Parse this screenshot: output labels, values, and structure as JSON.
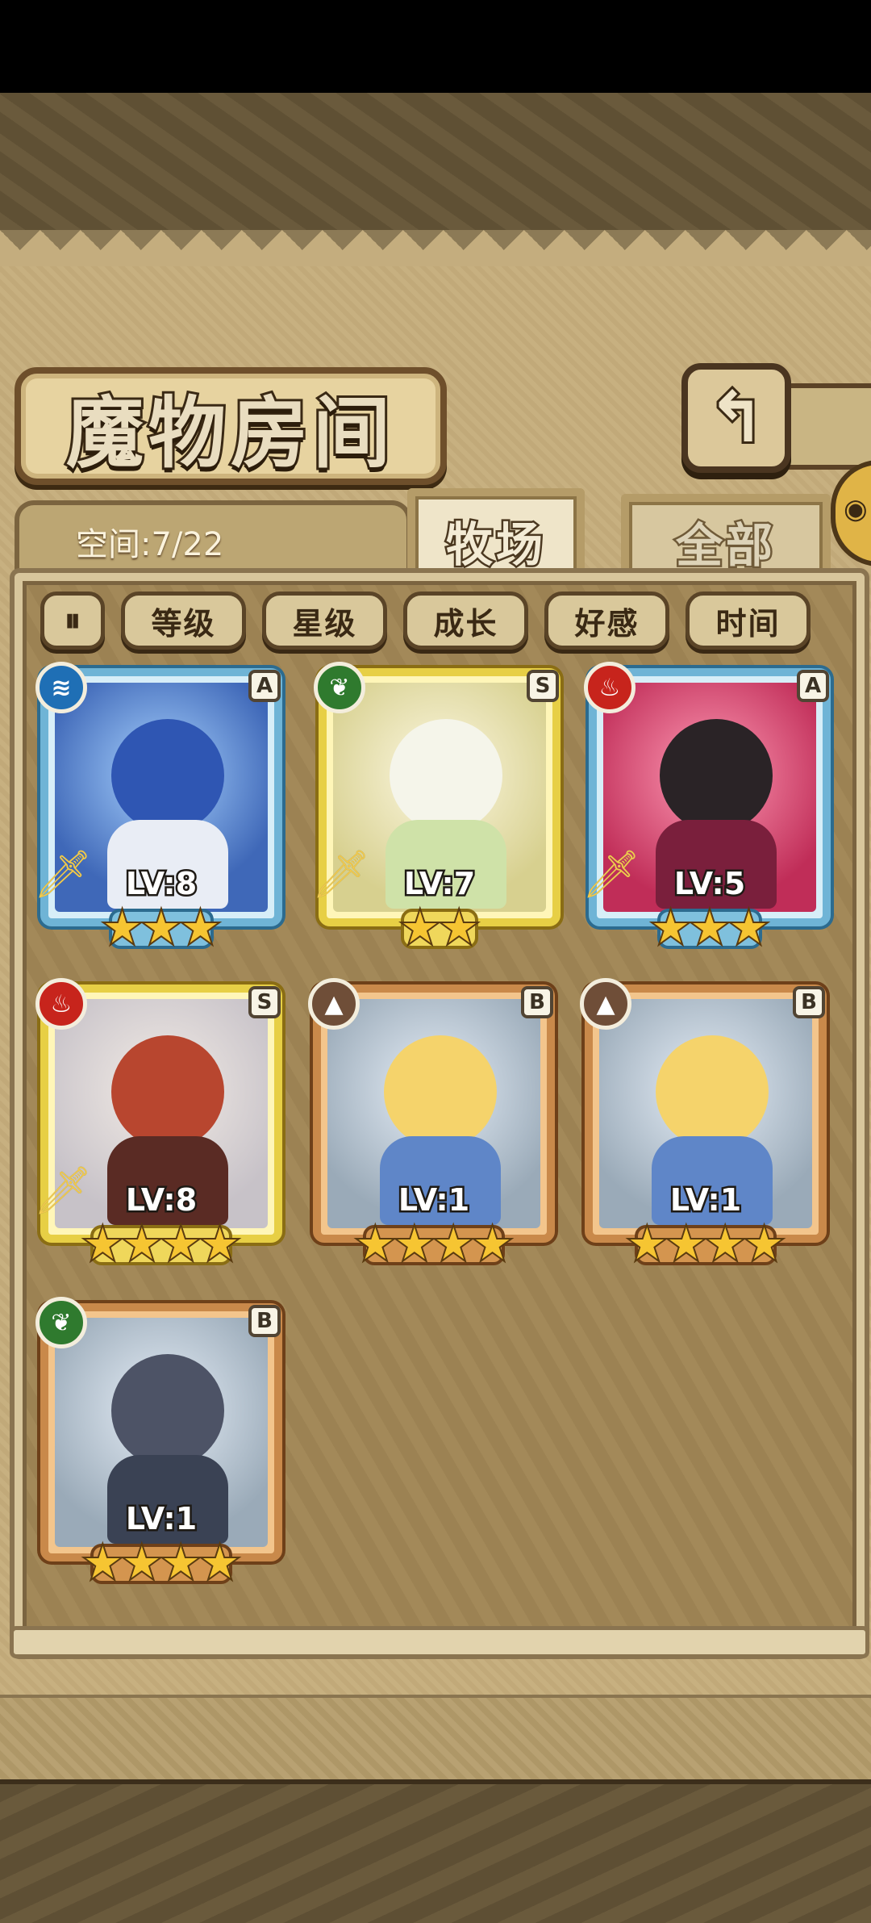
{
  "header": {
    "title": "魔物房间",
    "back_icon": "return-arrow-icon"
  },
  "status": {
    "space_label": "空间:7/22"
  },
  "tabs": [
    {
      "label": "牧场",
      "active": true
    },
    {
      "label": "全部",
      "active": false
    }
  ],
  "sort": {
    "toggle_glyph": "⏸",
    "options": [
      "等级",
      "星级",
      "成长",
      "好感",
      "时间"
    ]
  },
  "monsters": [
    {
      "rank": "A",
      "element": "water",
      "element_glyph": "≋",
      "level": "LV:8",
      "stars": 3,
      "frame": "blue",
      "has_weapon": true
    },
    {
      "rank": "S",
      "element": "grass",
      "element_glyph": "❦",
      "level": "LV:7",
      "stars": 2,
      "frame": "gold",
      "has_weapon": true
    },
    {
      "rank": "A",
      "element": "fire",
      "element_glyph": "♨",
      "level": "LV:5",
      "stars": 3,
      "frame": "blue",
      "has_weapon": true
    },
    {
      "rank": "S",
      "element": "fire",
      "element_glyph": "♨",
      "level": "LV:8",
      "stars": 4,
      "frame": "gold",
      "has_weapon": true
    },
    {
      "rank": "B",
      "element": "earth",
      "element_glyph": "▲",
      "level": "LV:1",
      "stars": 4,
      "frame": "bronze",
      "has_weapon": false
    },
    {
      "rank": "B",
      "element": "earth",
      "element_glyph": "▲",
      "level": "LV:1",
      "stars": 4,
      "frame": "bronze",
      "has_weapon": false
    },
    {
      "rank": "B",
      "element": "grass",
      "element_glyph": "❦",
      "level": "LV:1",
      "stars": 4,
      "frame": "bronze",
      "has_weapon": false
    }
  ],
  "colors": {
    "star": "#f6c532",
    "panel": "#a38959",
    "parchment": "#c7b080"
  }
}
